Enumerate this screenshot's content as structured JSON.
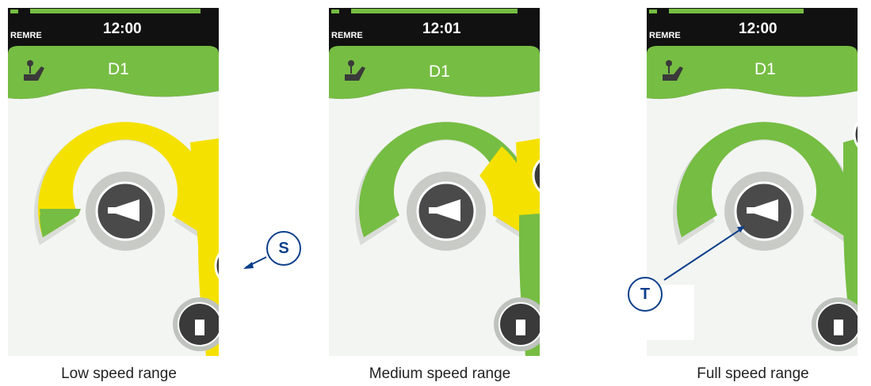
{
  "panels": [
    {
      "id": "low",
      "caption": "Low speed range",
      "time": "12:00",
      "device": "REMRE",
      "profile": "D1",
      "battery_fraction": 0.95,
      "yellow_from": 0.0,
      "green_portion": 0.2
    },
    {
      "id": "medium",
      "caption": "Medium speed range",
      "time": "12:01",
      "device": "REMRE",
      "profile": "D1",
      "battery_fraction": 0.92,
      "yellow_from": 0.75,
      "green_portion": 0.75
    },
    {
      "id": "full",
      "caption": "Full speed range",
      "time": "12:00",
      "device": "REMRE",
      "profile": "D1",
      "battery_fraction": 0.76,
      "yellow_from": 1.0,
      "green_portion": 1.0
    }
  ],
  "callouts": {
    "s": "S",
    "t": "T"
  },
  "colors": {
    "green": "#76bd43",
    "yellow": "#f5e100",
    "dark": "#3a3a3a",
    "callout": "#0b3f8a"
  },
  "icons": [
    "horn-icon",
    "joystick-seat-icon",
    "touch-move-icon",
    "speed-arrow-icon",
    "battery-icon"
  ]
}
